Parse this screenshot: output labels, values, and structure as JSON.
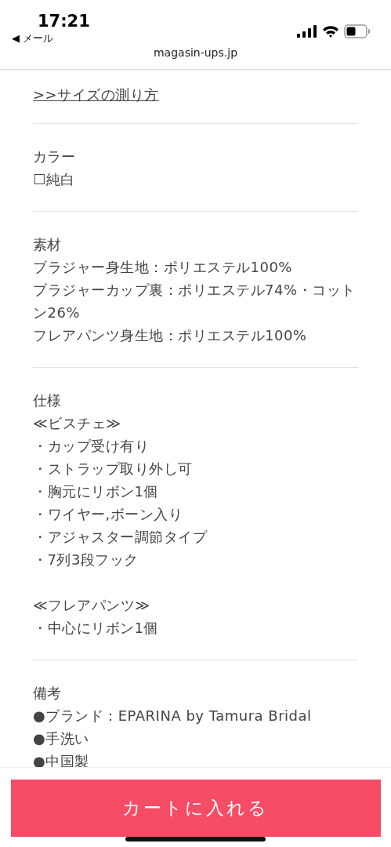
{
  "status_bar": {
    "time": "17:21",
    "back_label": "◀ メール"
  },
  "address_bar": {
    "url": "magasin-ups.jp"
  },
  "sections": [
    {
      "kind": "link",
      "text": ">>サイズの測り方"
    },
    {
      "kind": "info",
      "heading": "カラー",
      "paragraphs": [
        [
          "☐純白"
        ]
      ]
    },
    {
      "kind": "info",
      "heading": "素材",
      "paragraphs": [
        [
          "ブラジャー身生地：ポリエステル100%",
          "ブラジャーカップ裏：ポリエステル74%・コットン26%",
          "フレアパンツ身生地：ポリエステル100%"
        ]
      ]
    },
    {
      "kind": "info",
      "heading": "仕様",
      "paragraphs": [
        [
          "≪ビスチェ≫",
          "・カップ受け有り",
          "・ストラップ取り外し可",
          "・胸元にリボン1個",
          "・ワイヤー,ボーン入り",
          "・アジャスター調節タイプ",
          "・7列3段フック"
        ],
        [
          "≪フレアパンツ≫",
          "・中心にリボン1個"
        ]
      ]
    },
    {
      "kind": "info",
      "heading": "備考",
      "paragraphs": [
        [
          "●ブランド：EPARINA by Tamura Bridal",
          "●手洗い",
          "●中国製"
        ]
      ]
    }
  ],
  "cart_button": {
    "label": "カートに入れる"
  }
}
